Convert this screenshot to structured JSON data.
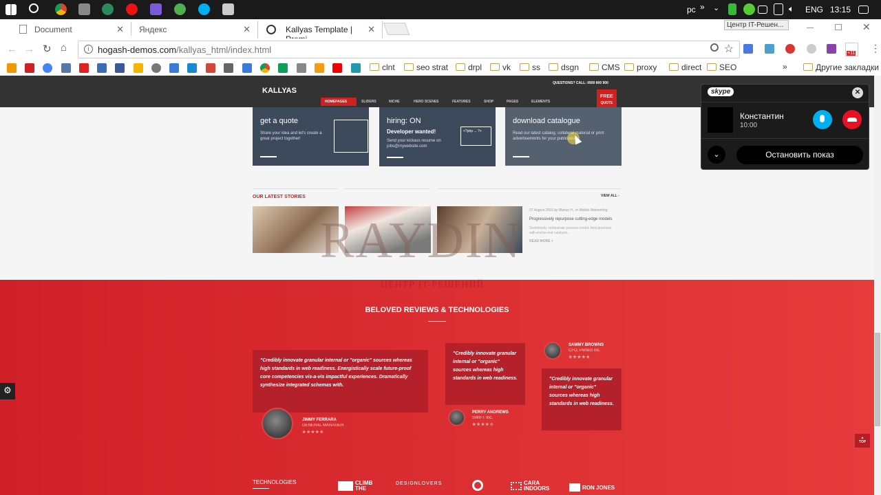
{
  "taskbar": {
    "lang": "ENG",
    "time": "13:15",
    "user": "pc",
    "chevron": "»"
  },
  "browser": {
    "tabs": [
      {
        "label": "Document"
      },
      {
        "label": "Яндекс"
      },
      {
        "label": "Kallyas Template | Premi"
      }
    ],
    "window_title_hint": "Центр IT-Решен...",
    "url_host": "hogash-demos.com",
    "url_path": "/kallyas_html/index.html",
    "bookmarks": [
      {
        "label": "clnt",
        "folder": true
      },
      {
        "label": "seo strat",
        "folder": true
      },
      {
        "label": "drpl",
        "folder": true
      },
      {
        "label": "vk",
        "folder": true
      },
      {
        "label": "ss",
        "folder": true
      },
      {
        "label": "dsgn",
        "folder": true
      },
      {
        "label": "CMS",
        "folder": true
      },
      {
        "label": "proxy",
        "folder": true
      },
      {
        "label": "direct",
        "folder": true
      },
      {
        "label": "SEO",
        "folder": true
      }
    ],
    "bookmarks_more": "»",
    "other_bookmarks": "Другие закладки",
    "ext_badge": "+11"
  },
  "site": {
    "logo": "KALLYAS",
    "questions": "QUESTIONS? CALL: 0900 800 900",
    "free_quote": [
      "FREE",
      "QUOTE"
    ],
    "nav": [
      "HOMEPAGES",
      "SLIDERS",
      "NICHE",
      "HERO SCENES",
      "FEATURES",
      "SHOP",
      "PAGES",
      "ELEMENTS"
    ],
    "cards": [
      {
        "title": "get a quote",
        "subtitle": "",
        "text": "Share your idea and let's create a great project together!"
      },
      {
        "title": "hiring: ON",
        "subtitle": "Developer wanted!",
        "text": "Send your kickass resume on jobs@mywebsite.com"
      },
      {
        "title": "download catalogue",
        "subtitle": "",
        "text": "Read our latest catalog, collateral material or print advertisements for your publication."
      }
    ],
    "code_snippet": "<?php ... ?>",
    "stories_title": "OUR LATEST STORIES",
    "view_all": "VIEW ALL -",
    "story_meta": "07 August 2016 by Marius H., in Mobile Networking",
    "story_title": "Progressively repurpose cutting-edge models",
    "story_text": "Seamlessly orchestrate process-centric best practices with end-to-end catalysts...",
    "read_more": "READ MORE +",
    "watermark": "RAYDIN",
    "watermark_sub": "ЦЕНТР IT-РЕШЕНИЙ",
    "reviews_title": "BELOVED REVIEWS & TECHNOLOGIES",
    "reviews": [
      {
        "text": "\"Credibly innovate granular internal or \"organic\" sources whereas high standards in web readiness. Energistically scale future-proof core competencies vis-a-vis impactful experiences. Dramatically synthesize integrated schemas with.",
        "name": "JIMMY FERRARA",
        "role": "GENERAL MANAGER",
        "stars": "★★★★★"
      },
      {
        "text": "\"Credibly innovate granular internal or \"organic\" sources whereas high standards in web readiness.",
        "name": "PERRY ANDREWS",
        "role": "SWIFT Inc.",
        "stars": "★★★★☆"
      },
      {
        "text": "\"Credibly innovate granular internal or \"organic\" sources whereas high standards in web readiness.",
        "name": "SAMMY BROWNS",
        "role": "CFO, Perfect Inc.",
        "stars": "★★★★★"
      }
    ],
    "technologies_label": "TECHNOLOGIES",
    "tech_logos": [
      "CLIMB THE",
      "DESIGNLOVERS",
      "CARA INDOORS",
      "RON JONES"
    ],
    "top_button": "TOP"
  },
  "skype": {
    "brand": "skype",
    "caller": "Константин",
    "duration": "10:00",
    "stop_share": "Остановить показ"
  },
  "colors": {
    "accent_red": "#cd2122",
    "header_dark": "#333333",
    "card_blue": "#3c4a5c",
    "skype_blue": "#00aff0",
    "hangup_red": "#e81123"
  }
}
